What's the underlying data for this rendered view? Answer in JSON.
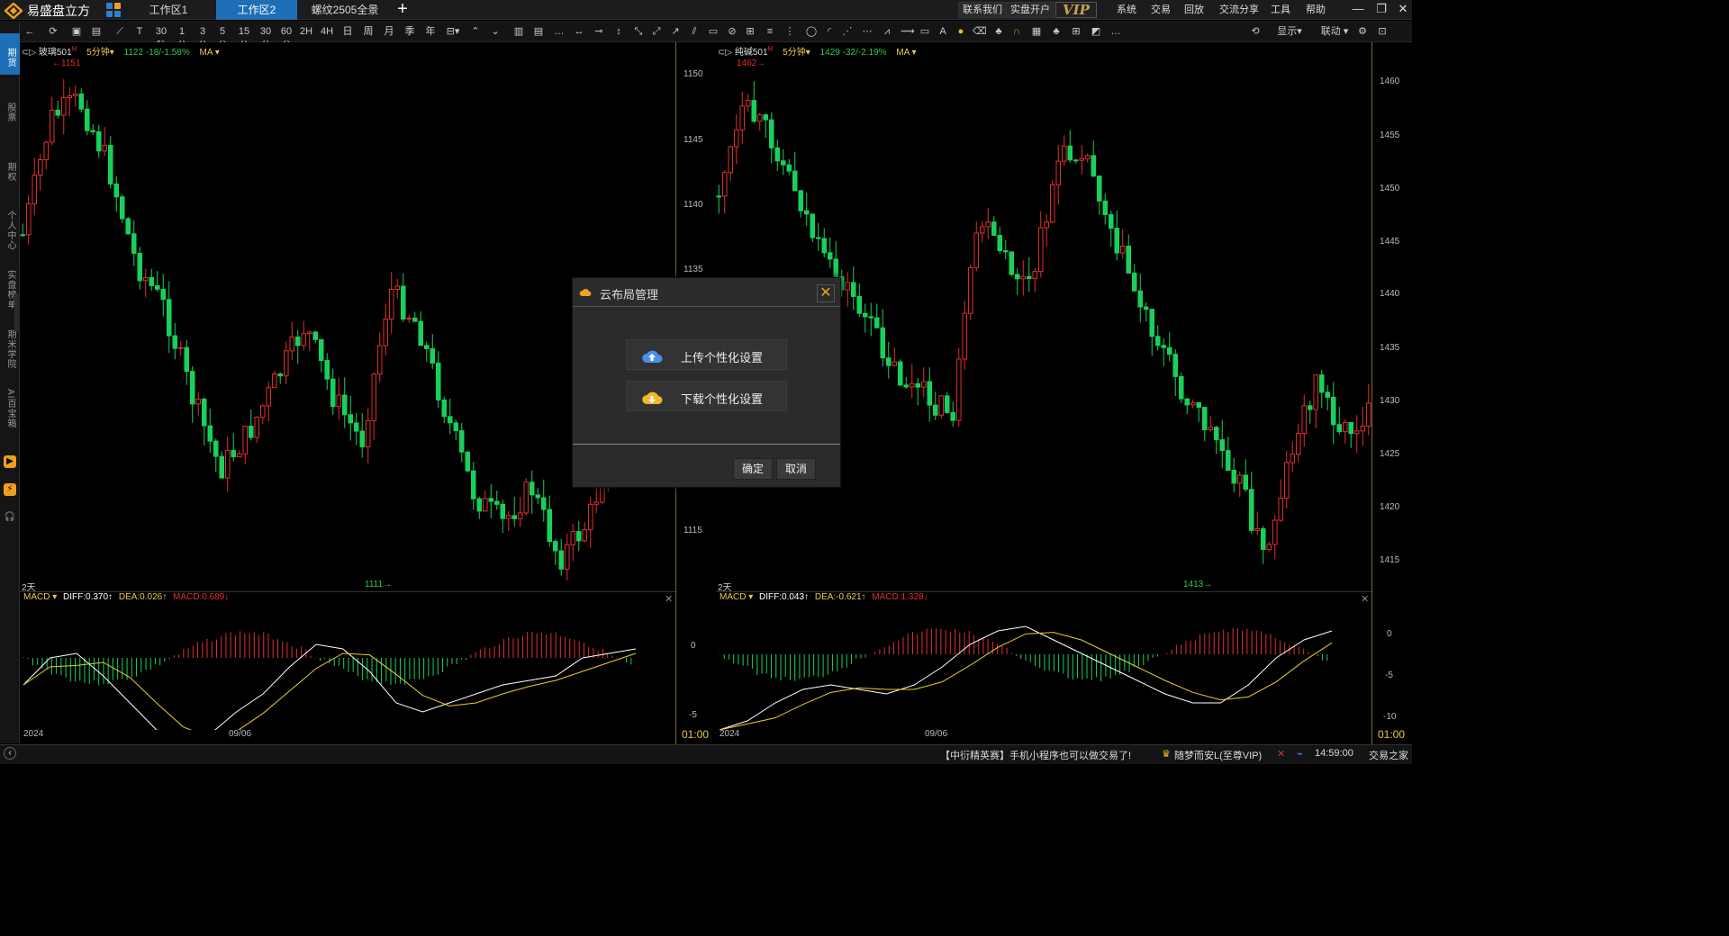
{
  "app": {
    "name": "易盛盘立方"
  },
  "tabs": [
    {
      "label": "工作区1",
      "active": false
    },
    {
      "label": "工作区2",
      "active": true
    },
    {
      "label": "螺纹2505全景",
      "active": false
    }
  ],
  "title_buttons": {
    "contact": "联系我们",
    "open_account": "实盘开户",
    "vip": "VIP"
  },
  "menu": [
    "系统",
    "交易",
    "回放",
    "交流分享",
    "工具",
    "帮助"
  ],
  "toolbar": {
    "periods": [
      "30秒",
      "1分",
      "3分",
      "5分",
      "15分",
      "30分",
      "60分",
      "2H",
      "4H",
      "日",
      "周",
      "月",
      "季",
      "年"
    ],
    "display": "显示",
    "link": "联动"
  },
  "leftnav": {
    "items": [
      "期货",
      "股票",
      "期权",
      "个人中心",
      "实盘榜单",
      "期米学院",
      "AI百宝箱"
    ]
  },
  "left_chart": {
    "symbol": "玻璃501",
    "marker": "M",
    "period": "5分钟",
    "quote": "1122  -18/-1.58%",
    "indicator": "MA",
    "high_label": "1151",
    "low_label": "1111",
    "range_label": "2天",
    "price_axis": [
      "1150",
      "1145",
      "1140",
      "1135",
      "1115"
    ],
    "macd": {
      "name": "MACD",
      "diff": "DIFF:0.370↑",
      "dea": "DEA:0.026↑",
      "macd": "MACD:0.689↓"
    },
    "macd_axis": [
      "0",
      "-5"
    ],
    "date_left": "2024",
    "date_mid": "09/06",
    "time": "01:00"
  },
  "right_chart": {
    "symbol": "纯碱501",
    "marker": "M",
    "period": "5分钟",
    "quote": "1429  -32/-2.19%",
    "indicator": "MA",
    "high_label": "1462",
    "low_label": "1413",
    "range_label": "2天",
    "price_axis": [
      "1460",
      "1455",
      "1450",
      "1445",
      "1440",
      "1435",
      "1430",
      "1425",
      "1420",
      "1415"
    ],
    "macd": {
      "name": "MACD",
      "diff": "DIFF:0.043↑",
      "dea": "DEA:-0.621↑",
      "macd": "MACD:1.328↓"
    },
    "macd_axis": [
      "0",
      "-5",
      "-10"
    ],
    "date_left": "2024",
    "date_mid": "09/06",
    "time": "01:00"
  },
  "dialog": {
    "title": "云布局管理",
    "upload": "上传个性化设置",
    "download": "下载个性化设置",
    "ok": "确定",
    "cancel": "取消"
  },
  "status": {
    "news": "【中衍精英赛】手机小程序也可以做交易了!",
    "user": "随梦而安L(至尊VIP)",
    "time": "14:59:00",
    "home": "交易之家"
  },
  "colors": {
    "up": "#e03030",
    "down": "#18d05a",
    "accent": "#1e6fb6",
    "ma": "#e8c94c"
  }
}
